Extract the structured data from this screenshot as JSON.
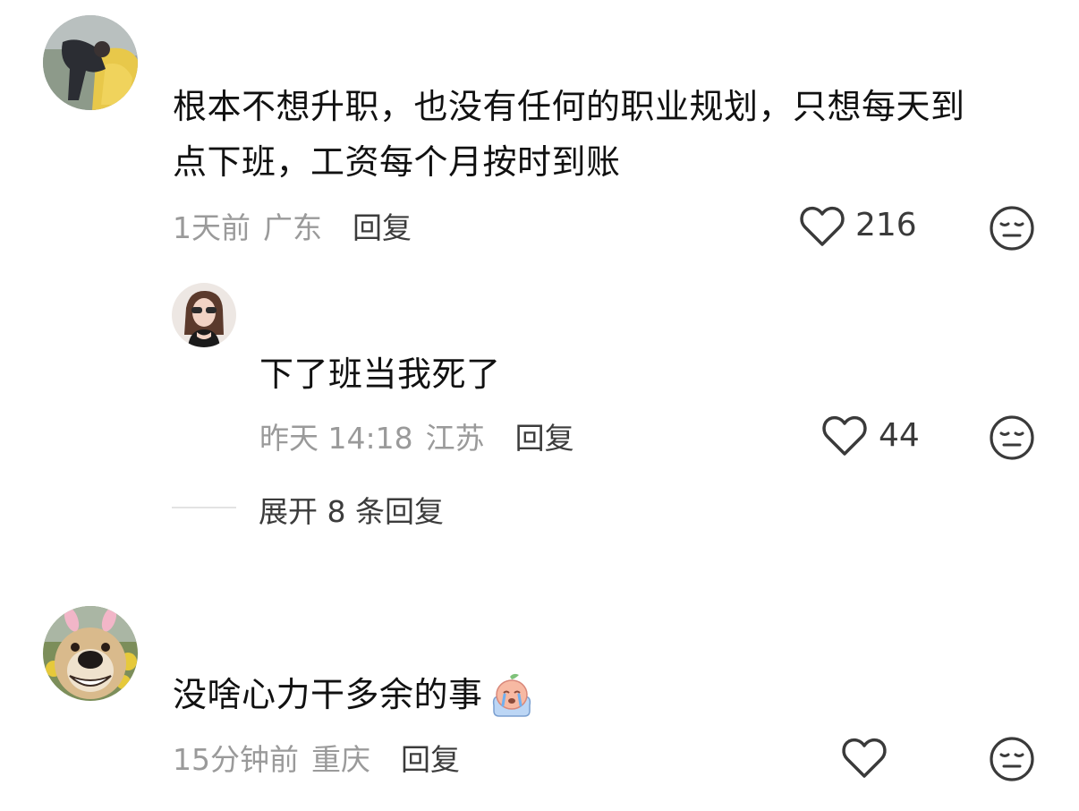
{
  "comments": [
    {
      "text_lines": [
        "根本不想升职，也没有任何的职业规划，只想每天到",
        "点下班，工资每个月按时到账"
      ],
      "time": "1天前",
      "location": "广东",
      "reply_label": "回复",
      "likes": "216",
      "replies": [
        {
          "text": "下了班当我死了",
          "time": "昨天 14:18",
          "location": "江苏",
          "reply_label": "回复",
          "likes": "44"
        }
      ],
      "expand_label": "展开 8 条回复"
    },
    {
      "text": "没啥心力干多余的事",
      "emoji_icon": "crying-peach-emoji-icon",
      "time": "15分钟前",
      "location": "重庆",
      "reply_label": "回复",
      "likes": ""
    }
  ],
  "icons": {
    "like": "heart-outline-icon",
    "dislike": "meh-face-icon"
  },
  "colors": {
    "text": "#111111",
    "meta": "#9a9a9a",
    "action": "#3c3c3c",
    "icon": "#3a3a3a"
  }
}
